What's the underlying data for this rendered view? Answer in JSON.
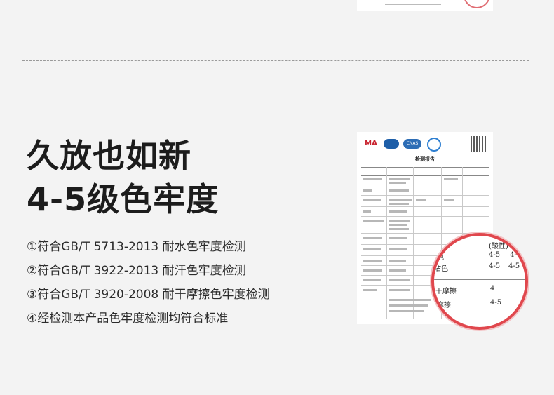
{
  "headline": {
    "line1": "久放也如新",
    "line2": "4-5级色牢度"
  },
  "features": [
    "①符合GB/T 5713-2013 耐水色牢度检测",
    "②符合GB/T 3922-2013 耐汗色牢度检测",
    "③符合GB/T 3920-2008 耐干摩擦色牢度检测",
    "④经检测本产品色牢度检测均符合标准"
  ],
  "report": {
    "title": "检测报告",
    "logos": [
      "MA",
      "CNAS"
    ]
  },
  "magnifier": {
    "header": "(酸性)",
    "rows": [
      {
        "label": "色",
        "v1": "4-5",
        "v2": "4-"
      },
      {
        "label": "沾色",
        "v1": "4-5",
        "v2": "4-5"
      },
      {
        "label": "干摩擦",
        "v1": "4",
        "v2": ""
      },
      {
        "label": "摩擦",
        "v1": "4-5",
        "v2": ""
      }
    ]
  },
  "colors": {
    "accent": "#e0474d",
    "background": "#f3f3f3"
  }
}
